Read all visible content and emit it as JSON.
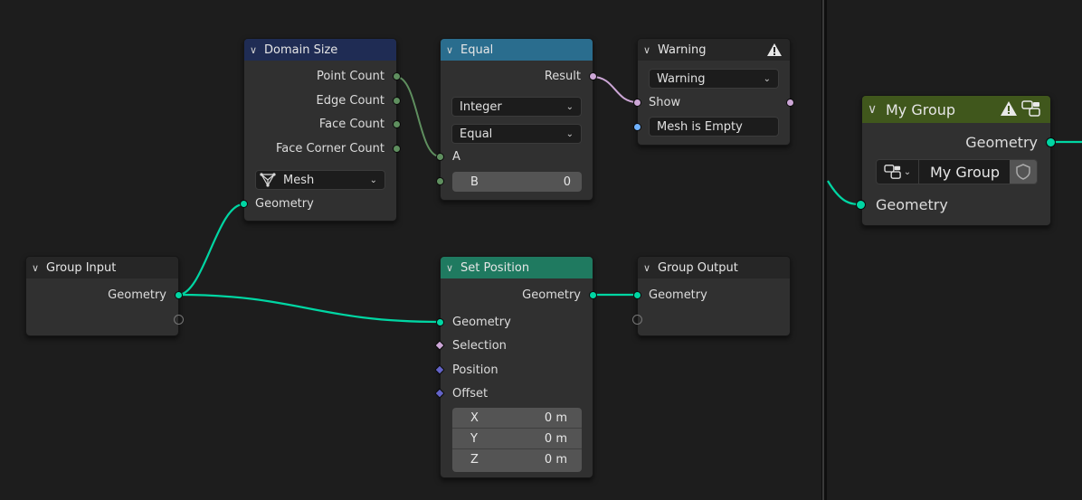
{
  "colors": {
    "geometry_socket": "#00d6a3",
    "integer_socket": "#5f8f5f",
    "boolean_socket": "#cca6d6",
    "string_socket": "#70b2ff",
    "vector_socket": "#6363c7",
    "background": "#1d1d1d"
  },
  "domain_size": {
    "title": "Domain Size",
    "outputs": [
      "Point Count",
      "Edge Count",
      "Face Count",
      "Face Corner Count"
    ],
    "component": "Mesh",
    "input": "Geometry"
  },
  "equal": {
    "title": "Equal",
    "output": "Result",
    "data_type": "Integer",
    "operation": "Equal",
    "input_a": "A",
    "input_b_label": "B",
    "input_b_value": "0"
  },
  "warning": {
    "title": "Warning",
    "type": "Warning",
    "show": "Show",
    "message": "Mesh is Empty"
  },
  "group_input": {
    "title": "Group Input",
    "output": "Geometry"
  },
  "set_position": {
    "title": "Set Position",
    "output": "Geometry",
    "inputs": [
      "Geometry",
      "Selection",
      "Position",
      "Offset"
    ],
    "offset": [
      {
        "axis": "X",
        "value": "0 m"
      },
      {
        "axis": "Y",
        "value": "0 m"
      },
      {
        "axis": "Z",
        "value": "0 m"
      }
    ]
  },
  "group_output": {
    "title": "Group Output",
    "input": "Geometry"
  },
  "my_group": {
    "title": "My Group",
    "output": "Geometry",
    "group_name": "My Group",
    "input": "Geometry"
  }
}
